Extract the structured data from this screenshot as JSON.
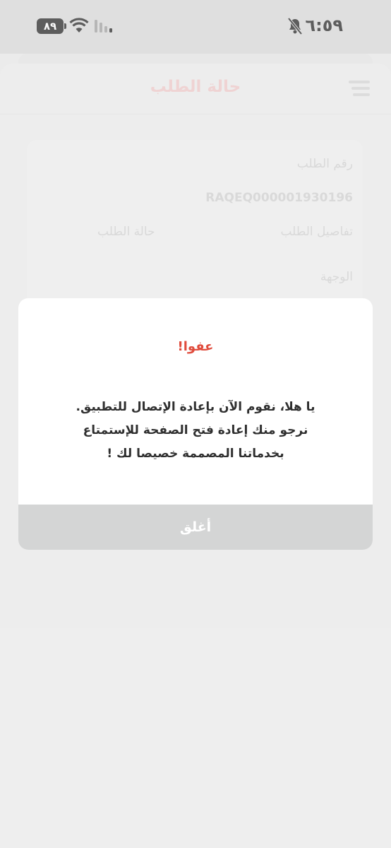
{
  "status_bar": {
    "time": "٦:٥٩",
    "battery": "٨٩",
    "icons": [
      "bell-off-icon",
      "wifi-icon",
      "signal-icon",
      "battery-icon"
    ]
  },
  "header": {
    "title": "حالة الطلب",
    "menu_icon": "hamburger-menu-icon"
  },
  "order": {
    "number_label": "رقم الطلب",
    "number_value": "RAQEQ000001930196",
    "details_label": "تفاصيل الطلب",
    "status_label": "حالة الطلب",
    "destination_label": "الوجهة"
  },
  "dialog": {
    "title": "عفوا!",
    "message_lines": [
      "يا هلا، نقوم الآن بإعادة الإتصال للتطبيق.",
      "نرجو منك إعادة فتح الصفحة للإستمتاع",
      "بخدماتنا المصممة خصيصا لك !"
    ],
    "close_label": "أغلق"
  },
  "colors": {
    "title_accent": "#e04b3c",
    "close_button_bg": "#d4d5d5",
    "header_title_faded": "#f1c7c7"
  }
}
